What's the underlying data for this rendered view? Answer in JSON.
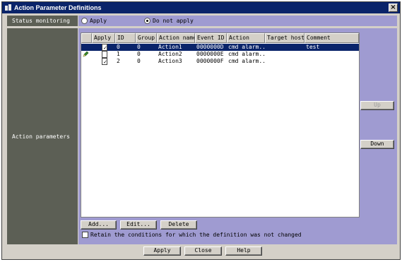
{
  "window": {
    "title": "Action Parameter Definitions",
    "close_label": "×"
  },
  "status_monitoring": {
    "label": "Status monitoring",
    "options": [
      {
        "label": "Apply",
        "selected": false
      },
      {
        "label": "Do not apply",
        "selected": true
      }
    ]
  },
  "action_parameters": {
    "label": "Action parameters",
    "columns": [
      "Apply",
      "ID",
      "Group",
      "Action name",
      "Event ID",
      "Action",
      "Target host",
      "Comment"
    ],
    "rows": [
      {
        "apply": true,
        "id": "0",
        "group": "0",
        "name": "Action1",
        "event_id": "0000000D",
        "action": "cmd alarm...",
        "target": "",
        "comment": "test",
        "selected": true,
        "edit_marker": false
      },
      {
        "apply": false,
        "id": "1",
        "group": "0",
        "name": "Action2",
        "event_id": "0000000E",
        "action": "cmd alarm...",
        "target": "",
        "comment": "",
        "selected": false,
        "edit_marker": true
      },
      {
        "apply": true,
        "id": "2",
        "group": "0",
        "name": "Action3",
        "event_id": "0000000F",
        "action": "cmd alarm...",
        "target": "",
        "comment": "",
        "selected": false,
        "edit_marker": false
      }
    ],
    "up_label": "Up",
    "down_label": "Down",
    "add_label": "Add...",
    "edit_label": "Edit...",
    "delete_label": "Delete",
    "retain_label": "Retain the conditions for which the definition was not changed",
    "retain_checked": false
  },
  "footer": {
    "apply_label": "Apply",
    "close_label": "Close",
    "help_label": "Help"
  },
  "colors": {
    "title_bar": "#0a246a",
    "label_bg": "#5c5f55",
    "content_bg": "#9f9bd1",
    "selected_row": "#0a246a"
  },
  "icons": {
    "title": "app-icon",
    "edit_marker": "pencil-icon"
  }
}
